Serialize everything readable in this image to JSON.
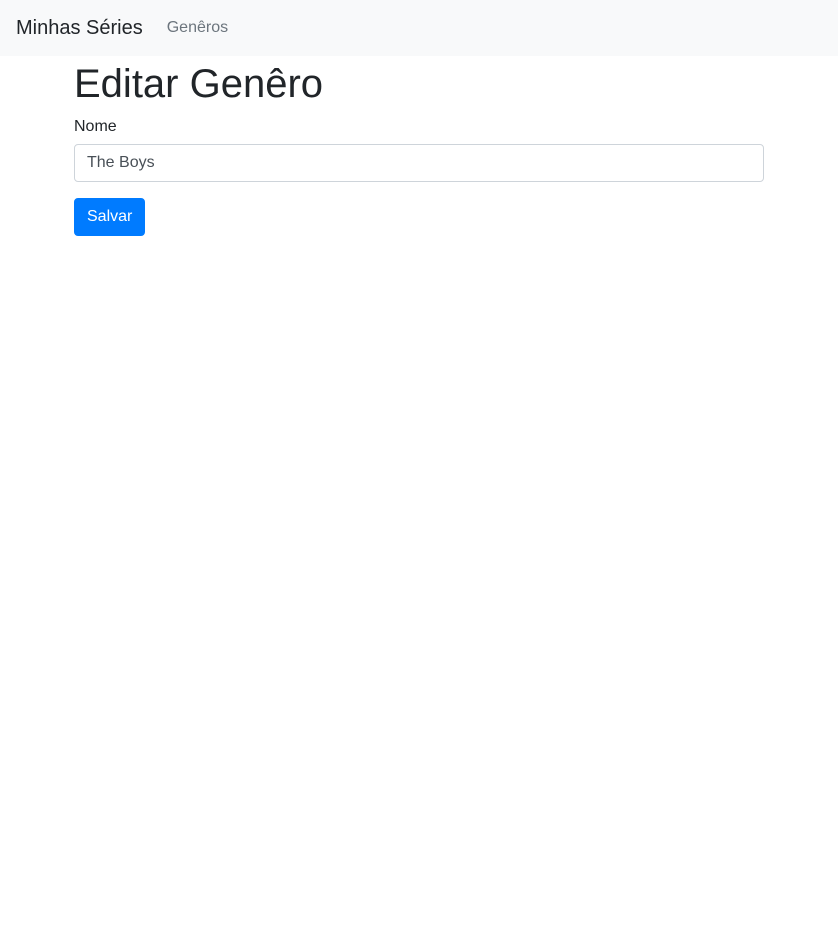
{
  "navbar": {
    "brand": "Minhas Séries",
    "links": [
      {
        "label": "Genêros"
      }
    ]
  },
  "page": {
    "title": "Editar Genêro"
  },
  "form": {
    "name_label": "Nome",
    "name_value": "The Boys",
    "submit_label": "Salvar"
  },
  "colors": {
    "navbar_bg": "#f8f9fa",
    "primary": "#007bff"
  }
}
